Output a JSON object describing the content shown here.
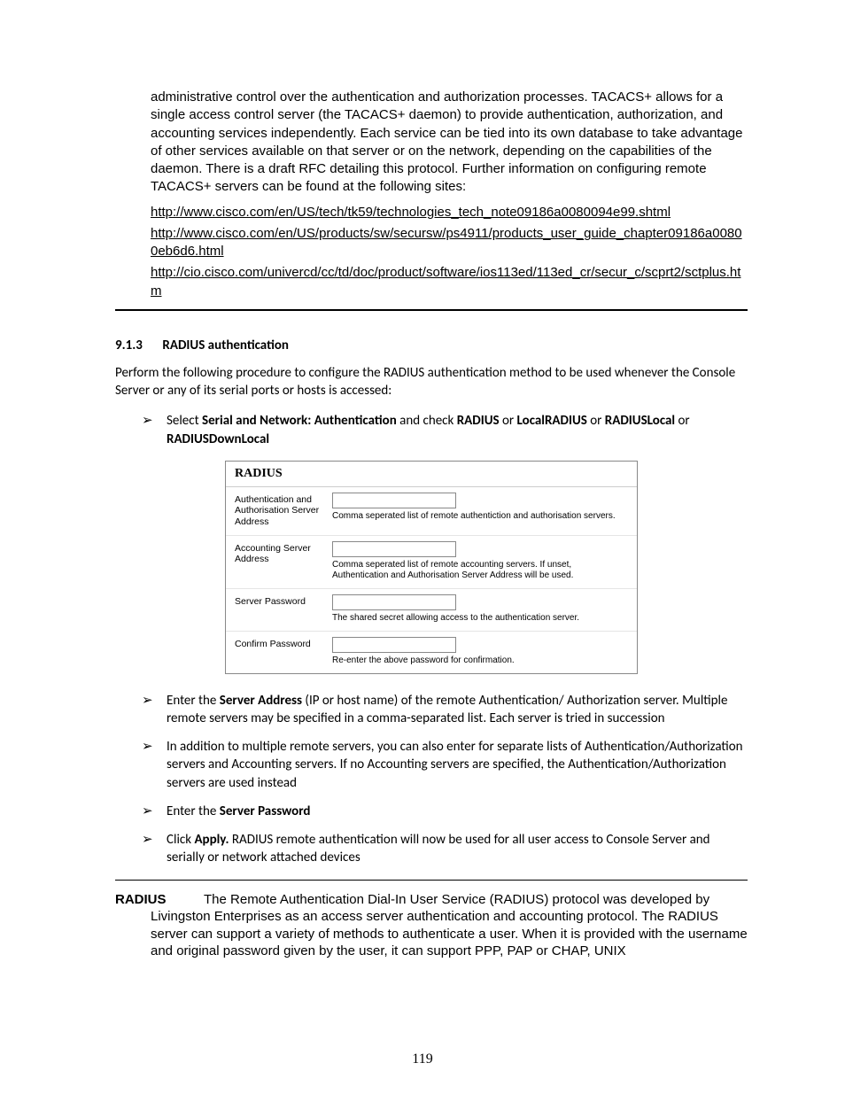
{
  "intro": "administrative control over the authentication and authorization processes. TACACS+ allows for a single access control server (the TACACS+ daemon) to provide authentication, authorization, and accounting services independently. Each service can be tied into its own database to take advantage of other services available on that server or on the network, depending on the capabilities of the daemon. There is a draft RFC detailing this protocol. Further information on configuring remote TACACS+ servers can be found at the following sites:",
  "links": [
    "http://www.cisco.com/en/US/tech/tk59/technologies_tech_note09186a0080094e99.shtml",
    "http://www.cisco.com/en/US/products/sw/secursw/ps4911/products_user_guide_chapter09186a00800eb6d6.html",
    "http://cio.cisco.com/univercd/cc/td/doc/product/software/ios113ed/113ed_cr/secur_c/scprt2/sctplus.htm"
  ],
  "section": {
    "number": "9.1.3",
    "title": "RADIUS authentication",
    "intro": "Perform the following procedure to configure the RADIUS authentication method to be used whenever the Console Server or any of its serial ports or hosts is accessed:"
  },
  "bullets1": {
    "select_prefix": "Select ",
    "select_bold1": "Serial and Network: Authentication",
    "select_mid": " and check  ",
    "select_bold2": "RADIUS",
    "select_or1": " or ",
    "select_bold3": "LocalRADIUS",
    "select_or2": " or ",
    "select_bold4": "RADIUSLocal",
    "select_or3": " or ",
    "select_bold5": "RADIUSDownLocal"
  },
  "radius": {
    "header": "RADIUS",
    "rows": [
      {
        "label": "Authentication and Authorisation Server Address",
        "hint": "Comma seperated list of remote authentiction and authorisation servers."
      },
      {
        "label": "Accounting Server Address",
        "hint": "Comma seperated list of remote accounting servers. If unset, Authentication and Authorisation Server Address will be used."
      },
      {
        "label": "Server Password",
        "hint": "The shared secret allowing access to the authentication server."
      },
      {
        "label": "Confirm Password",
        "hint": "Re-enter the above password for confirmation."
      }
    ]
  },
  "bullets2": {
    "b1_pre": "Enter the ",
    "b1_bold": "Server Address",
    "b1_post": " (IP or host name) of the remote Authentication/ Authorization server. Multiple remote servers may be specified in a comma-separated list. Each server is tried in succession",
    "b2": "In addition to multiple remote servers, you can also enter for separate lists of Authentication/Authorization servers and Accounting servers. If no Accounting servers are specified, the Authentication/Authorization servers are used instead",
    "b3_pre": "Enter the ",
    "b3_bold": "Server Password",
    "b4_pre": "Click ",
    "b4_bold": "Apply.",
    "b4_post": " RADIUS remote authentication will now be used for all user access to Console Server and serially or network attached devices"
  },
  "definition": {
    "term": "RADIUS",
    "line1": "The Remote Authentication Dial-In User Service (RADIUS) protocol was developed by",
    "rest": "Livingston Enterprises as an access server authentication and accounting protocol. The RADIUS server can support a variety of methods to authenticate a user. When it is provided with the username and original password given by the user, it can support PPP, PAP or CHAP, UNIX"
  },
  "pageNumber": "119"
}
